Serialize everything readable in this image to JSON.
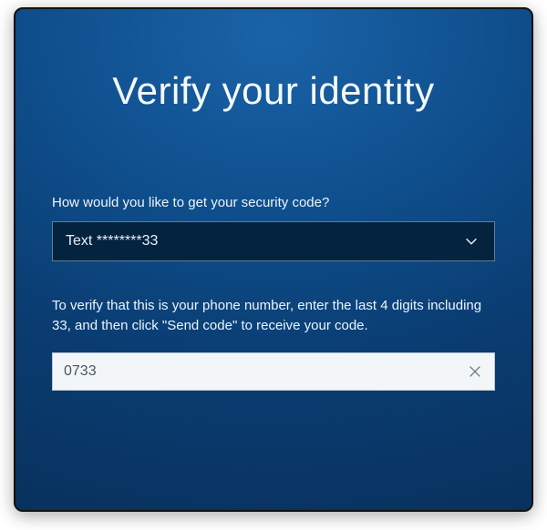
{
  "title": "Verify your identity",
  "prompt": "How would you like to get your security code?",
  "method": {
    "selected": "Text ********33"
  },
  "instruction": "To verify that this is your phone number, enter the last 4 digits including 33, and then click \"Send code\" to receive your code.",
  "input": {
    "value": "0733"
  }
}
